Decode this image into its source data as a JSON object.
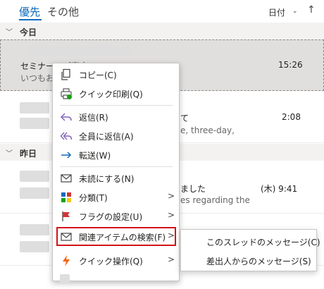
{
  "tabs": {
    "focused": "優先",
    "other": "その他"
  },
  "sort": {
    "label": "日付",
    "chevron": "⌄",
    "arrow": "↑"
  },
  "groups": {
    "today": "今日",
    "yesterday": "昨日"
  },
  "mails": [
    {
      "subject": "セミナーのご案内",
      "preview": "いつもお世",
      "time": "15:26"
    },
    {
      "subject": "て",
      "preview": "e, three-day,",
      "time": "2:08"
    },
    {
      "subject": "ました",
      "preview": "es regarding the",
      "time": "(木) 9:41"
    }
  ],
  "menu": {
    "items": [
      {
        "icon": "copy-icon",
        "label": "コピー(C)"
      },
      {
        "icon": "quick-print-icon",
        "label": "クイック印刷(Q)"
      },
      {
        "icon": "reply-icon",
        "label": "返信(R)",
        "color": "#8764b8"
      },
      {
        "icon": "reply-all-icon",
        "label": "全員に返信(A)",
        "color": "#8764b8"
      },
      {
        "icon": "forward-icon",
        "label": "転送(W)",
        "color": "#0f6cbd"
      },
      {
        "icon": "mark-unread-icon",
        "label": "未読にする(N)"
      },
      {
        "icon": "categorize-icon",
        "label": "分類(T)"
      },
      {
        "icon": "flag-icon",
        "label": "フラグの設定(U)",
        "color": "#d13438"
      },
      {
        "icon": "find-related-icon",
        "label": "関連アイテムの検索(F)"
      },
      {
        "icon": "quick-steps-icon",
        "label": "クイック操作(Q)",
        "color": "#f7630c"
      }
    ],
    "submenu_arrow": ">"
  },
  "submenu": {
    "items": [
      {
        "label": "このスレッドのメッセージ(C)"
      },
      {
        "label": "差出人からのメッセージ(S)"
      }
    ]
  },
  "colors": {
    "accent": "#0f6cbd",
    "highlight_border": "#d1131b"
  }
}
